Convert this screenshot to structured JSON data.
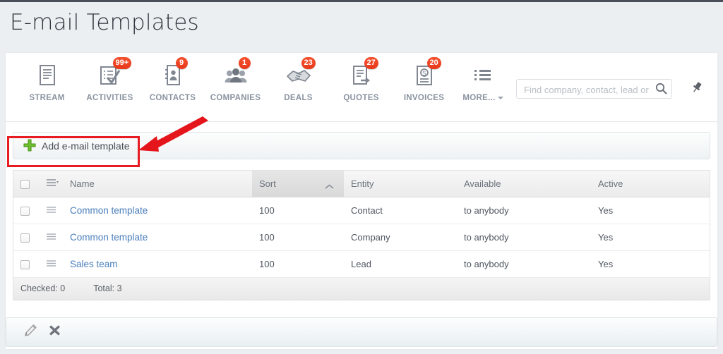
{
  "page": {
    "title": "E-mail Templates"
  },
  "nav": {
    "items": [
      {
        "label": "STREAM",
        "icon": "document-lines-icon",
        "badge": ""
      },
      {
        "label": "ACTIVITIES",
        "icon": "checklist-icon",
        "badge": "99+"
      },
      {
        "label": "CONTACTS",
        "icon": "contact-card-icon",
        "badge": "9"
      },
      {
        "label": "COMPANIES",
        "icon": "people-group-icon",
        "badge": "1"
      },
      {
        "label": "DEALS",
        "icon": "handshake-icon",
        "badge": "23"
      },
      {
        "label": "QUOTES",
        "icon": "quote-doc-icon",
        "badge": "27"
      },
      {
        "label": "INVOICES",
        "icon": "invoice-doc-icon",
        "badge": "20"
      }
    ],
    "more_label": "MORE...",
    "more_icon": "list-bullets-icon",
    "search": {
      "placeholder": "Find company, contact, lead or",
      "value": "",
      "icon": "search-icon"
    },
    "pin_icon": "pin-icon"
  },
  "action_bar": {
    "add_label": "Add e-mail template",
    "add_icon": "plus-icon"
  },
  "grid": {
    "columns": [
      {
        "key": "check",
        "label": ""
      },
      {
        "key": "menu",
        "label": ""
      },
      {
        "key": "name",
        "label": "Name"
      },
      {
        "key": "sort",
        "label": "Sort",
        "sorted": "asc"
      },
      {
        "key": "entity",
        "label": "Entity"
      },
      {
        "key": "avail",
        "label": "Available"
      },
      {
        "key": "active",
        "label": "Active"
      }
    ],
    "rows": [
      {
        "name": "Common template",
        "sort": "100",
        "entity": "Contact",
        "available": "to anybody",
        "active": "Yes"
      },
      {
        "name": "Common template",
        "sort": "100",
        "entity": "Company",
        "available": "to anybody",
        "active": "Yes"
      },
      {
        "name": "Sales team",
        "sort": "100",
        "entity": "Lead",
        "available": "to anybody",
        "active": "Yes"
      }
    ],
    "footer": {
      "checked": "Checked: 0",
      "total": "Total: 3"
    }
  },
  "bottom_toolbar": {
    "edit_icon": "pencil-icon",
    "delete_icon": "x-cross-icon"
  },
  "annotation": {
    "highlight_color": "#e81b23",
    "arrow_color": "#e4161c"
  },
  "colors": {
    "badge": "#f04124",
    "link": "#4a7ebb",
    "page_bg": "#eceff1",
    "nav_label": "#8a93a0"
  }
}
